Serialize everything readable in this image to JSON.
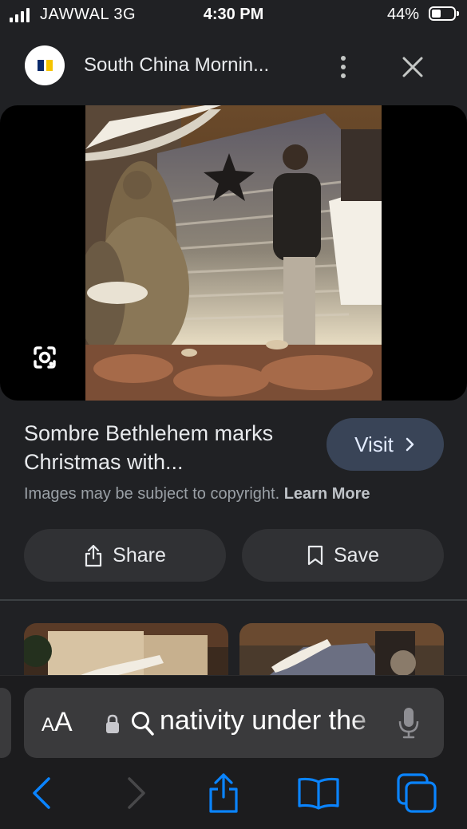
{
  "status_bar": {
    "carrier": "JAWWAL  3G",
    "time": "4:30 PM",
    "battery": "44%",
    "battery_level": 0.44
  },
  "header": {
    "site_name": "South China Mornin..."
  },
  "result": {
    "title": "Sombre Bethlehem marks Christmas with...",
    "visit_label": "Visit",
    "copyright_text": "Images may be subject to copyright.",
    "learn_more": "Learn More"
  },
  "actions": {
    "share_label": "Share",
    "save_label": "Save"
  },
  "address_bar": {
    "text_size_label_small": "A",
    "text_size_label_big": "A",
    "query": "nativity under the"
  },
  "icons": [
    "site-logo",
    "more-vertical-icon",
    "close-icon",
    "google-lens-icon",
    "chevron-right-icon",
    "share-icon",
    "bookmark-icon",
    "lock-icon",
    "search-icon",
    "microphone-icon",
    "back-icon",
    "forward-icon",
    "share-icon",
    "bookmarks-icon",
    "tabs-icon"
  ],
  "colors": {
    "background": "#202124",
    "visit_button": "#394457",
    "pill": "#303134",
    "ios_blue": "#0a84ff",
    "toolbar": "#1c1c1e"
  }
}
